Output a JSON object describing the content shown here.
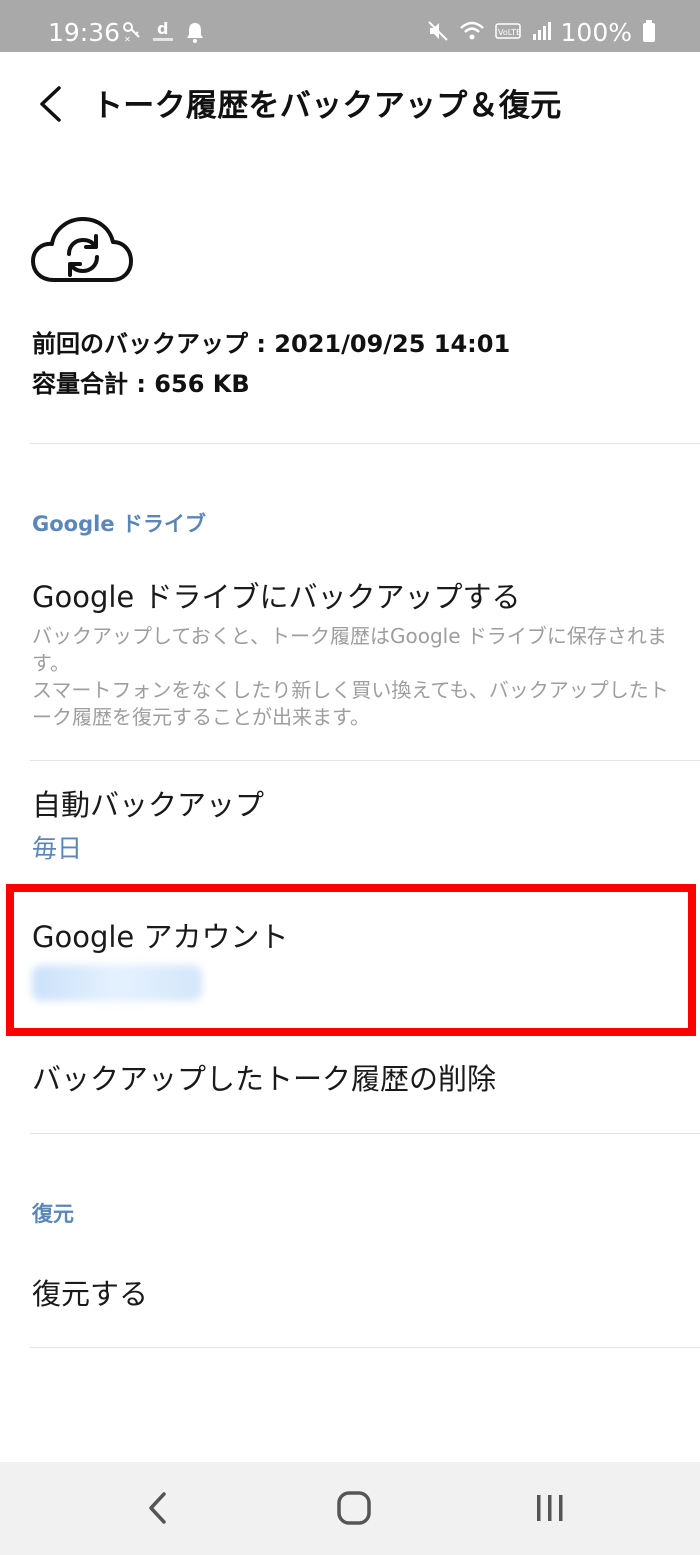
{
  "status_bar": {
    "time": "19:36",
    "battery": "100%",
    "left_icons": [
      "key-notification-icon",
      "d-magazine-icon",
      "bell-icon"
    ],
    "right_icons": [
      "mute-icon",
      "wifi-icon",
      "volte-icon",
      "signal-icon",
      "battery-icon"
    ]
  },
  "header": {
    "title": "トーク履歴をバックアップ＆復元",
    "back_icon": "chevron-left-icon"
  },
  "backup_info": {
    "icon": "cloud-sync-icon",
    "last_backup": "前回のバックアップ : 2021/09/25 14:01",
    "total_size": "容量合計 : 656 KB"
  },
  "google_drive_section": {
    "header": "Google ドライブ",
    "backup_item": {
      "title": "Google ドライブにバックアップする",
      "description_line1": "バックアップしておくと、トーク履歴はGoogle ドライブに保存されます。",
      "description_line2": "スマートフォンをなくしたり新しく買い換えても、バックアップしたトーク履歴を復元することが出来ます。"
    },
    "auto_backup": {
      "title": "自動バックアップ",
      "value": "毎日"
    },
    "google_account": {
      "title": "Google アカウント"
    },
    "delete_item": {
      "title": "バックアップしたトーク履歴の削除"
    }
  },
  "restore_section": {
    "header": "復元",
    "restore_item": {
      "title": "復元する"
    }
  },
  "annotation": {
    "highlight_color": "#ff0000"
  },
  "colors": {
    "accent": "#5b86b8",
    "status_bar": "#a9a9a9",
    "nav_bar": "#f1f1f1"
  },
  "nav_bar": {
    "icons": [
      "back-icon",
      "home-icon",
      "recent-apps-icon"
    ]
  }
}
